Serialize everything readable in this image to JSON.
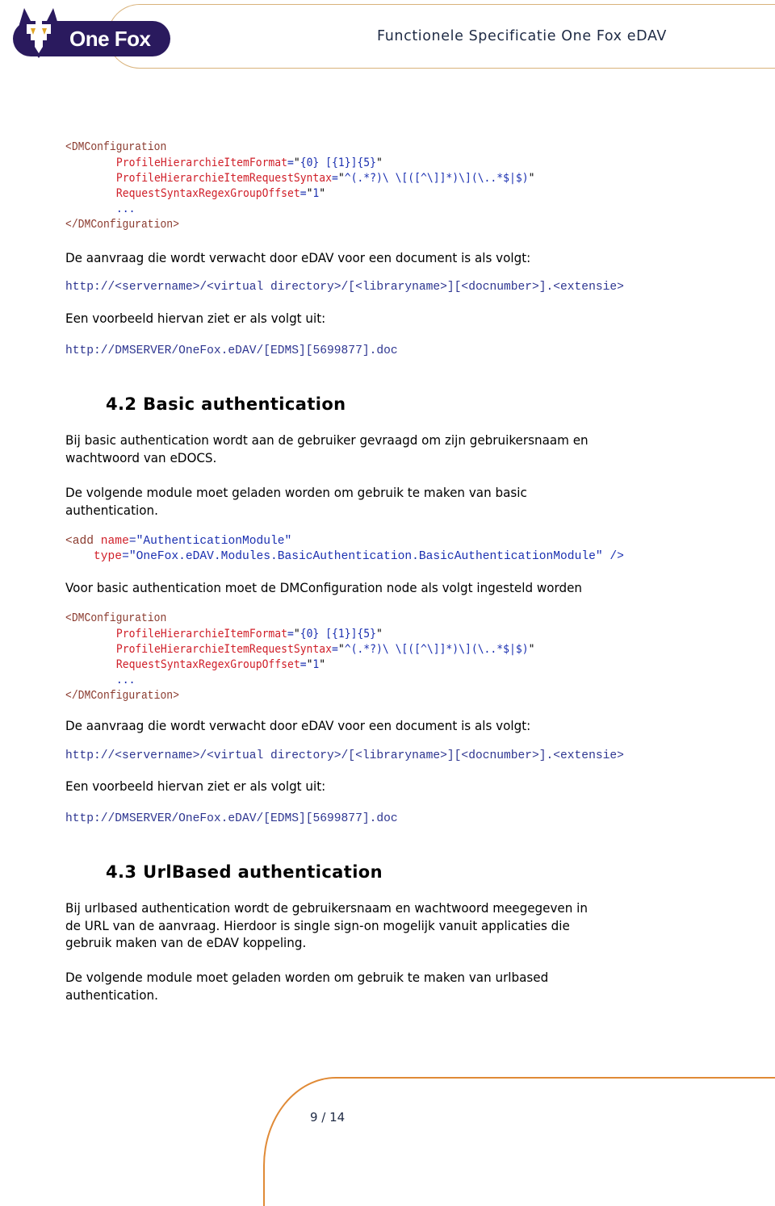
{
  "header": {
    "logo_text": "One Fox",
    "title": "Functionele Specificatie One Fox eDAV",
    "colors": {
      "logo_purple": "#2a1a5e",
      "logo_accent": "#e0a526",
      "border": "#d9b27a"
    }
  },
  "code1": {
    "open_tag": "<DMConfiguration",
    "attrs": [
      {
        "name": "ProfileHierarchieItemFormat",
        "value": "{0} [{1}]{5}"
      },
      {
        "name": "ProfileHierarchieItemRequestSyntax",
        "value": "^(.*?)\\ \\[([^\\]]*)\\](\\..*$|$)"
      },
      {
        "name": "RequestSyntaxRegexGroupOffset",
        "value": "1"
      }
    ],
    "ellipsis": "...",
    "close_tag": "</DMConfiguration>"
  },
  "sec41_tail": {
    "request_intro": "De aanvraag die wordt verwacht door eDAV voor een document is als volgt:",
    "request_pattern": "http://<servername>/<virtual directory>/[<libraryname>][<docnumber>].<extensie>",
    "example_intro": "Een voorbeeld hiervan ziet er als volgt uit:",
    "example_url": "http://DMSERVER/OneFox.eDAV/[EDMS][5699877].doc"
  },
  "sec42": {
    "number": "4.2",
    "title": "Basic authentication",
    "para1_line1": "Bij basic authentication wordt aan de gebruiker gevraagd om zijn gebruikersnaam en",
    "para1_line2": "wachtwoord van eDOCS.",
    "para2_line1": "De volgende module moet geladen worden om gebruik te maken van basic",
    "para2_line2": "authentication.",
    "module": {
      "tag": "<add",
      "name_attr": "name",
      "name_value": "AuthenticationModule",
      "type_attr": "type",
      "type_value": "OneFox.eDAV.Modules.BasicAuthentication.BasicAuthenticationModule",
      "close": " />"
    },
    "config_intro": "Voor basic authentication moet de DMConfiguration node als volgt ingesteld worden",
    "code": {
      "open_tag": "<DMConfiguration",
      "attrs": [
        {
          "name": "ProfileHierarchieItemFormat",
          "value": "{0} [{1}]{5}"
        },
        {
          "name": "ProfileHierarchieItemRequestSyntax",
          "value": "^(.*?)\\ \\[([^\\]]*)\\](\\..*$|$)"
        },
        {
          "name": "RequestSyntaxRegexGroupOffset",
          "value": "1"
        }
      ],
      "ellipsis": "...",
      "close_tag": "</DMConfiguration>"
    },
    "request_intro": "De aanvraag die wordt verwacht door eDAV voor een document is als volgt:",
    "request_pattern": "http://<servername>/<virtual directory>/[<libraryname>][<docnumber>].<extensie>",
    "example_intro": "Een voorbeeld hiervan ziet er als volgt uit:",
    "example_url": "http://DMSERVER/OneFox.eDAV/[EDMS][5699877].doc"
  },
  "sec43": {
    "number": "4.3",
    "title": "UrlBased authentication",
    "para1_line1": "Bij urlbased authentication wordt de gebruikersnaam en wachtwoord meegegeven in",
    "para1_line2": "de URL van de aanvraag. Hierdoor is single sign-on mogelijk vanuit applicaties die",
    "para1_line3": "gebruik maken van de eDAV koppeling.",
    "para2_line1": "De volgende module moet geladen worden om gebruik te maken van urlbased",
    "para2_line2": "authentication."
  },
  "footer": {
    "page_indicator": "9 / 14",
    "colors": {
      "border": "#e08a36"
    }
  }
}
